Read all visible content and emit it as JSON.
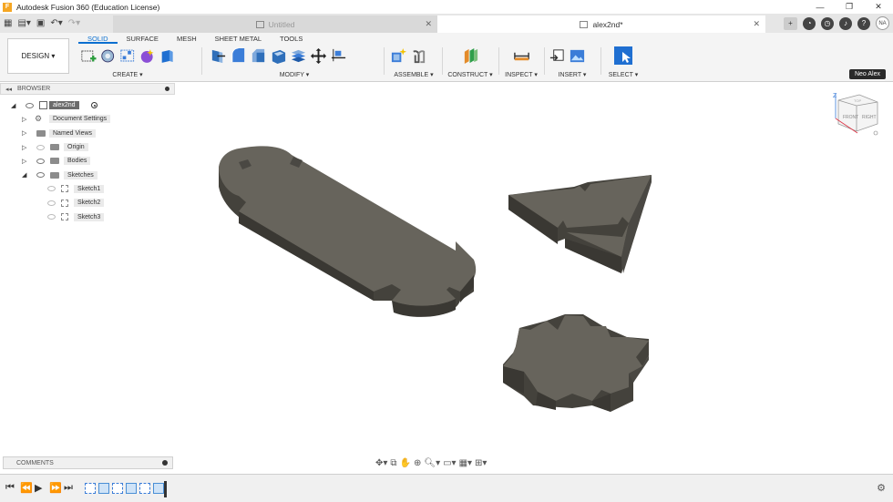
{
  "titlebar": {
    "title": "Autodesk Fusion 360 (Education License)",
    "icon": "F"
  },
  "window_controls": [
    "—",
    "❐",
    "✕"
  ],
  "tabs": [
    {
      "label": "Untitled",
      "active": false
    },
    {
      "label": "alex2nd*",
      "active": true
    }
  ],
  "user": {
    "initials": "NA",
    "badge": "Neo Alex"
  },
  "design_button": "DESIGN ▾",
  "workspace_tabs": [
    "SOLID",
    "SURFACE",
    "MESH",
    "SHEET METAL",
    "TOOLS"
  ],
  "tool_groups": [
    {
      "label": "CREATE ▾"
    },
    {
      "label": "MODIFY ▾"
    },
    {
      "label": "ASSEMBLE ▾"
    },
    {
      "label": "CONSTRUCT ▾"
    },
    {
      "label": "INSPECT ▾"
    },
    {
      "label": "INSERT ▾"
    },
    {
      "label": "SELECT ▾"
    }
  ],
  "browser": {
    "title": "BROWSER",
    "items": [
      {
        "label": "alex2nd"
      },
      {
        "label": "Document Settings"
      },
      {
        "label": "Named Views"
      },
      {
        "label": "Origin"
      },
      {
        "label": "Bodies"
      },
      {
        "label": "Sketches"
      },
      {
        "label": "Sketch1"
      },
      {
        "label": "Sketch2"
      },
      {
        "label": "Sketch3"
      }
    ]
  },
  "comments": {
    "label": "COMMENTS"
  },
  "viewcube": {
    "faces": [
      "FRONT",
      "RIGHT",
      "TOP"
    ],
    "axis": "Z"
  },
  "colors": {
    "accent": "#0a6fd0",
    "body": "#65625a",
    "body_dark": "#44423c"
  }
}
